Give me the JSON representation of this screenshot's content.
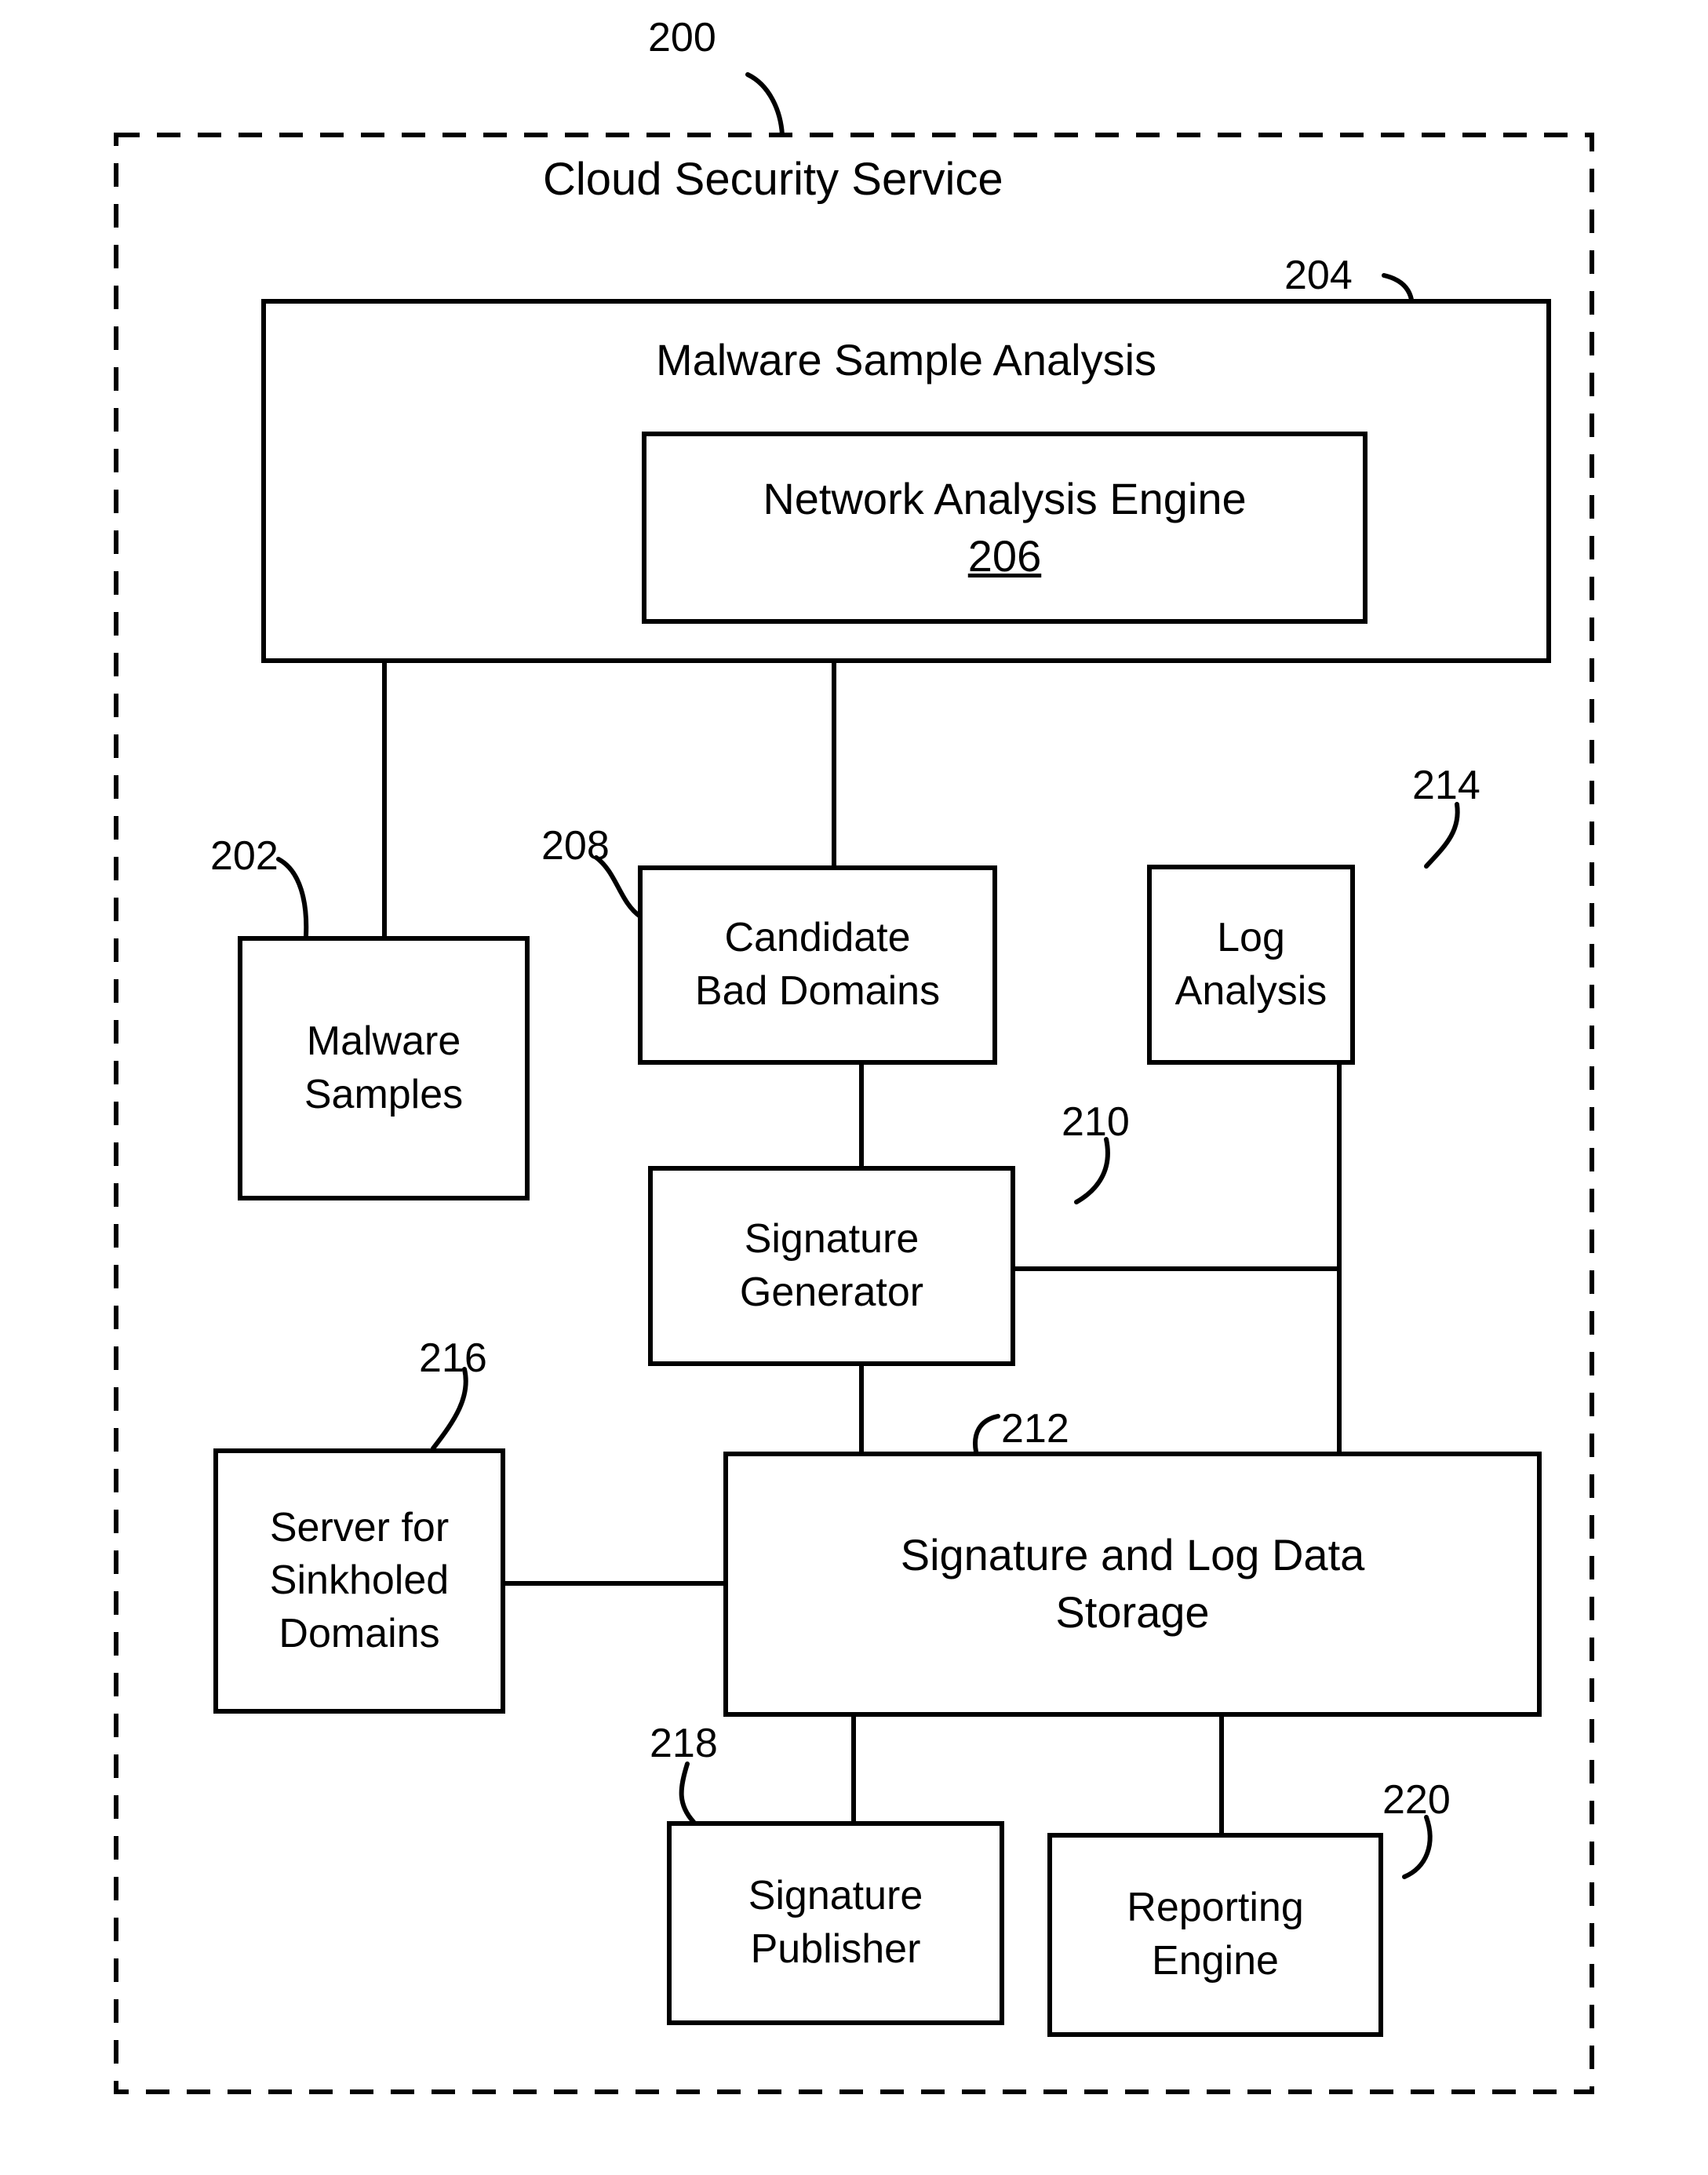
{
  "figure": {
    "container": {
      "ref": "200",
      "title": "Cloud Security Service"
    },
    "nodes": [
      {
        "id": "204",
        "ref": "204",
        "label": "Malware Sample Analysis"
      },
      {
        "id": "206",
        "ref": "206",
        "label": "Network Analysis Engine",
        "ref_inline": "206"
      },
      {
        "id": "202",
        "ref": "202",
        "label": "Malware\nSamples"
      },
      {
        "id": "208",
        "ref": "208",
        "label": "Candidate\nBad Domains"
      },
      {
        "id": "214",
        "ref": "214",
        "label": "Log\nAnalysis"
      },
      {
        "id": "210",
        "ref": "210",
        "label": "Signature\nGenerator"
      },
      {
        "id": "216",
        "ref": "216",
        "label": "Server for\nSinkholed\nDomains"
      },
      {
        "id": "212",
        "ref": "212",
        "label": "Signature and Log Data\nStorage"
      },
      {
        "id": "218",
        "ref": "218",
        "label": "Signature\nPublisher"
      },
      {
        "id": "220",
        "ref": "220",
        "label": "Reporting\nEngine"
      }
    ],
    "colors": {
      "line": "#000000",
      "background": "#ffffff"
    }
  }
}
